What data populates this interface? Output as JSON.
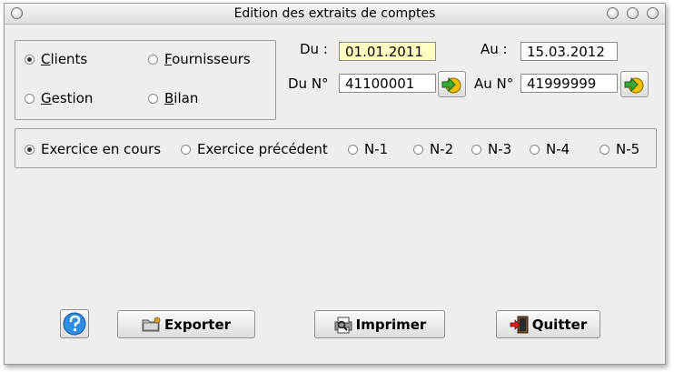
{
  "window": {
    "title": "Edition des extraits de comptes"
  },
  "account_type": {
    "options": [
      {
        "label": "Clients",
        "selected": true
      },
      {
        "label": "Fournisseurs",
        "selected": false
      },
      {
        "label": "Gestion",
        "selected": false
      },
      {
        "label": "Bilan",
        "selected": false
      }
    ]
  },
  "dates": {
    "from_label": "Du :",
    "from_value": "01.01.2011",
    "to_label": "Au :",
    "to_value": "15.03.2012"
  },
  "accounts": {
    "from_label": "Du N°",
    "from_value": "41100001",
    "to_label": "Au N°",
    "to_value": "41999999"
  },
  "period": {
    "options": [
      {
        "label": "Exercice en cours",
        "selected": true
      },
      {
        "label": "Exercice précédent",
        "selected": false
      },
      {
        "label": "N-1",
        "selected": false
      },
      {
        "label": "N-2",
        "selected": false
      },
      {
        "label": "N-3",
        "selected": false
      },
      {
        "label": "N-4",
        "selected": false
      },
      {
        "label": "N-5",
        "selected": false
      }
    ]
  },
  "buttons": {
    "export": "Exporter",
    "print": "Imprimer",
    "quit": "Quitter"
  },
  "icons": {
    "help": "help-icon",
    "go": "arrow-go-icon",
    "export": "folder-export-icon",
    "print": "printer-icon",
    "quit": "exit-door-icon"
  },
  "colors": {
    "window_bg": "#efeeed",
    "date_field_bg": "#ffffc4",
    "go_icon": "#f0c000"
  }
}
